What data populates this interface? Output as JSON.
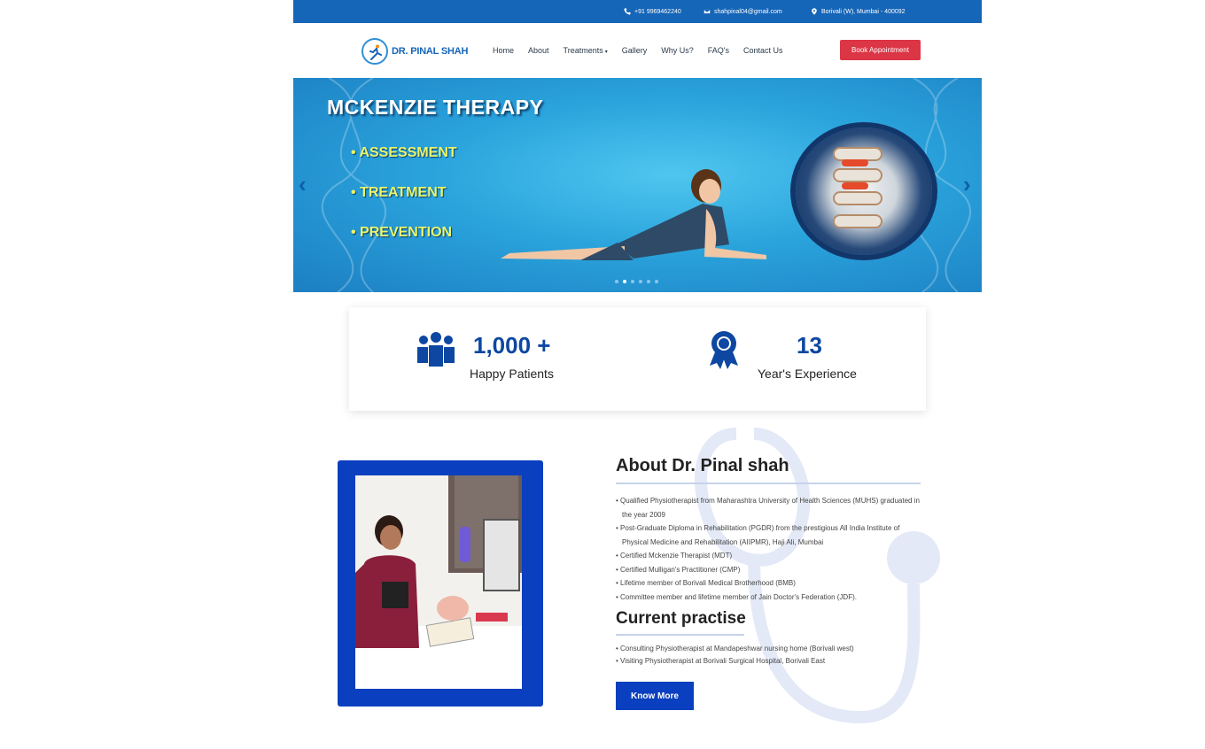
{
  "topbar": {
    "phone": "+91 9969462240",
    "email": "shahpinal04@gmail.com",
    "location": "Borivali (W), Mumbai - 400092"
  },
  "brand": {
    "name": "DR. PINAL SHAH"
  },
  "nav": {
    "links": [
      "Home",
      "About",
      "Treatments",
      "Gallery",
      "Why Us?",
      "FAQ's",
      "Contact Us"
    ],
    "dropdown_marker": "▾",
    "book_label": "Book Appointment"
  },
  "hero": {
    "title": "MCKENZIE THERAPY",
    "bullets": [
      "• ASSESSMENT",
      "• TREATMENT",
      "• PREVENTION"
    ],
    "prev_arrow": "‹",
    "next_arrow": "›",
    "slide_count": 6,
    "active_slide": 2
  },
  "stats": [
    {
      "number": "1,000 +",
      "label": "Happy Patients",
      "icon": "users-group-icon"
    },
    {
      "number": "13",
      "label": "Year's Experience",
      "icon": "award-ribbon-icon"
    }
  ],
  "about": {
    "title": "About Dr. Pinal shah",
    "points": [
      "Qualified Physiotherapist from Maharashtra University of Health Sciences (MUHS) graduated in the year 2009",
      "Post-Graduate Diploma in Rehabilitation (PGDR) from the prestigious All India Institute of Physical Medicine and Rehabilitation (AIIPMR), Haji Ali, Mumbai",
      "Certified Mckenzie Therapist (MDT)",
      "Certified Mulligan's Practitioner (CMP)",
      "Lifetime member of Borivali Medical Brotherhood (BMB)",
      "Committee member and lifetime member of Jain Doctor's Federation (JDF)."
    ],
    "practice_title": "Current practise",
    "practice_points": [
      "Consulting Physiotherapist at Mandapeshwar nursing home (Borivali west)",
      "Visiting Physiotherapist at Borivali Surgical Hospital, Borivali East"
    ],
    "button_label": "Know More"
  },
  "colors": {
    "topbar": "#1565b8",
    "accent_red": "#dc3545",
    "primary_blue": "#0a3fbf",
    "stat_blue": "#0d47a1",
    "hero_bullet": "#e9f56a"
  }
}
